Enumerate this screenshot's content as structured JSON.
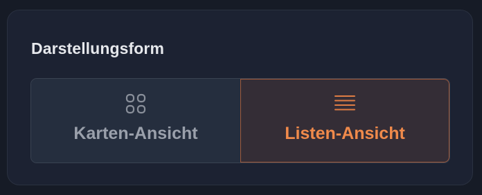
{
  "panel": {
    "title": "Darstellungsform"
  },
  "view_toggle": {
    "options": [
      {
        "label": "Karten-Ansicht",
        "icon": "grid-icon",
        "selected": false
      },
      {
        "label": "Listen-Ansicht",
        "icon": "list-icon",
        "selected": true
      }
    ]
  },
  "colors": {
    "accent": "#f08a4b",
    "inactive_text": "#9aa0ab",
    "title_text": "#e6e8ec"
  }
}
